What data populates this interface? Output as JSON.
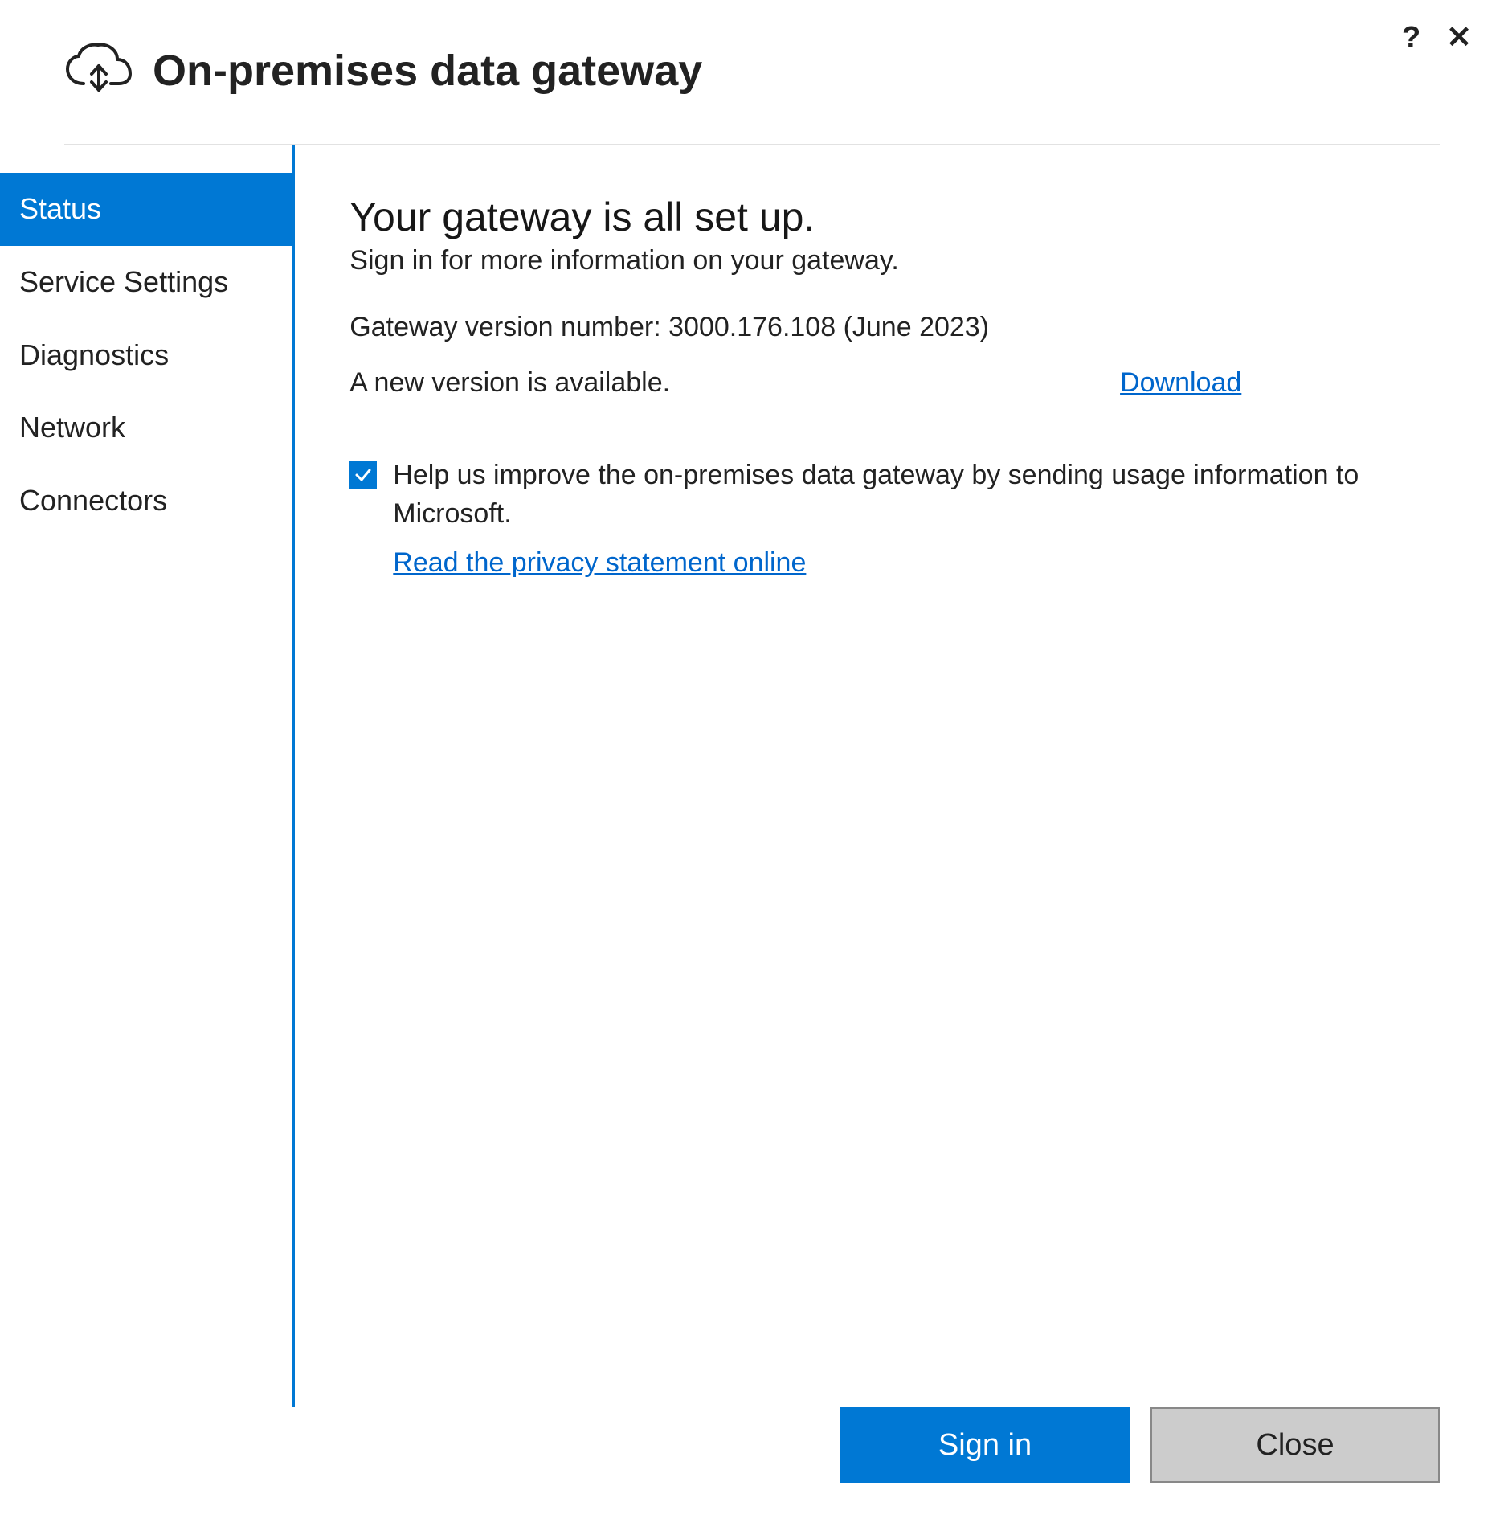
{
  "titlebar": {
    "help_symbol": "?",
    "close_symbol": "✕"
  },
  "header": {
    "title": "On-premises data gateway"
  },
  "sidebar": {
    "items": [
      {
        "label": "Status",
        "active": true
      },
      {
        "label": "Service Settings",
        "active": false
      },
      {
        "label": "Diagnostics",
        "active": false
      },
      {
        "label": "Network",
        "active": false
      },
      {
        "label": "Connectors",
        "active": false
      }
    ]
  },
  "content": {
    "heading": "Your gateway is all set up.",
    "subtitle": "Sign in for more information on your gateway.",
    "version_line": "Gateway version number: 3000.176.108 (June 2023)",
    "update_message": "A new version is available.",
    "download_label": "Download",
    "telemetry_text": "Help us improve the on-premises data gateway by sending usage information to Microsoft.",
    "telemetry_checked": true,
    "privacy_link": "Read the privacy statement online"
  },
  "footer": {
    "signin_label": "Sign in",
    "close_label": "Close"
  },
  "colors": {
    "accent": "#0078D4",
    "link": "#0066CC"
  }
}
